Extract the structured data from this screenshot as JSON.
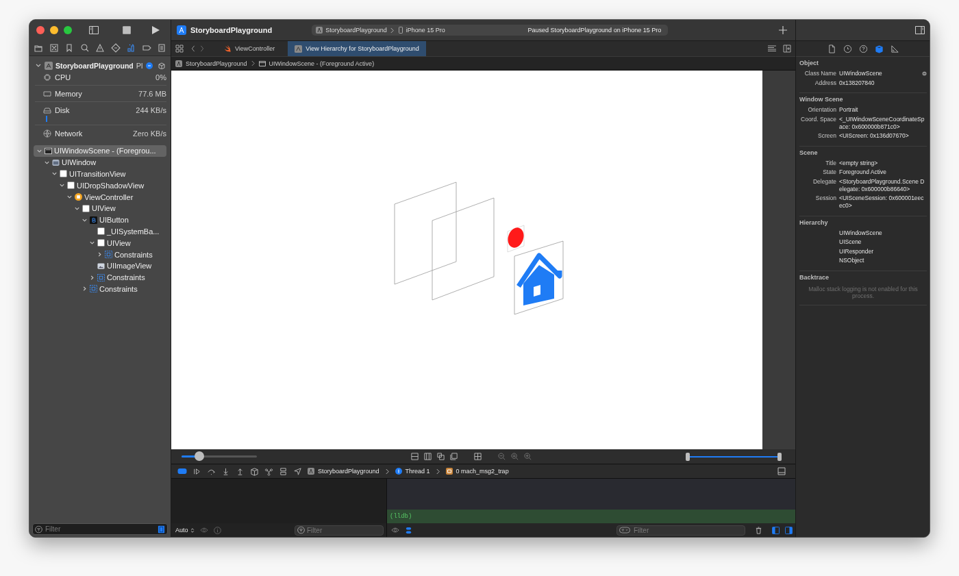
{
  "window": {
    "title": "StoryboardPlayground"
  },
  "toolbar": {
    "scheme": "StoryboardPlayground",
    "device": "iPhone 15 Pro",
    "status": "Paused StoryboardPlayground on iPhone 15 Pro"
  },
  "navigator_tabs": [
    {
      "selected": false
    },
    {
      "selected": false
    },
    {
      "selected": false
    },
    {
      "selected": false
    },
    {
      "selected": false
    },
    {
      "selected": false
    },
    {
      "selected": true
    },
    {
      "selected": false
    },
    {
      "selected": false
    }
  ],
  "process": {
    "name": "StoryboardPlayground",
    "name_suffix": "Pl",
    "metrics": [
      {
        "kind": "cpu",
        "label": "CPU",
        "value": "0%"
      },
      {
        "kind": "memory",
        "label": "Memory",
        "value": "77.6 MB"
      },
      {
        "kind": "disk",
        "label": "Disk",
        "value": "244 KB/s"
      },
      {
        "kind": "network",
        "label": "Network",
        "value": "Zero KB/s"
      }
    ]
  },
  "tree": [
    {
      "label": "UIWindowScene - (Foregrou...",
      "kind": "scene",
      "expandable": true,
      "expanded": true,
      "selected": true,
      "children": [
        {
          "label": "UIWindow",
          "kind": "window",
          "expandable": true,
          "expanded": true,
          "selected": false,
          "children": [
            {
              "label": "UITransitionView",
              "kind": "view",
              "expandable": true,
              "expanded": true,
              "selected": false,
              "children": [
                {
                  "label": "UIDropShadowView",
                  "kind": "view",
                  "expandable": true,
                  "expanded": true,
                  "selected": false,
                  "children": [
                    {
                      "label": "ViewController",
                      "kind": "controller",
                      "expandable": true,
                      "expanded": true,
                      "selected": false,
                      "children": [
                        {
                          "label": "UIView",
                          "kind": "view",
                          "expandable": true,
                          "expanded": true,
                          "selected": false,
                          "children": [
                            {
                              "label": "UIButton",
                              "kind": "button",
                              "expandable": true,
                              "expanded": true,
                              "selected": false,
                              "children": [
                                {
                                  "label": "_UISystemBa...",
                                  "kind": "view",
                                  "expandable": false,
                                  "selected": false
                                },
                                {
                                  "label": "UIView",
                                  "kind": "view",
                                  "expandable": true,
                                  "expanded": true,
                                  "selected": false,
                                  "children": [
                                    {
                                      "label": "Constraints",
                                      "kind": "constraints",
                                      "expandable": true,
                                      "expanded": false,
                                      "selected": false
                                    }
                                  ]
                                },
                                {
                                  "label": "UIImageView",
                                  "kind": "image",
                                  "expandable": false,
                                  "selected": false
                                },
                                {
                                  "label": "Constraints",
                                  "kind": "constraints",
                                  "expandable": true,
                                  "expanded": false,
                                  "selected": false
                                }
                              ]
                            },
                            {
                              "label": "Constraints",
                              "kind": "constraints",
                              "expandable": true,
                              "expanded": false,
                              "selected": false
                            }
                          ]
                        }
                      ]
                    }
                  ]
                }
              ]
            }
          ]
        }
      ]
    }
  ],
  "navigator_filter": {
    "placeholder": "Filter"
  },
  "editor_tabs": [
    {
      "label": "ViewController",
      "kind": "swift",
      "selected": false
    },
    {
      "label": "View Hierarchy for StoryboardPlayground",
      "kind": "hierarchy",
      "selected": true
    }
  ],
  "jump_bar": [
    "StoryboardPlayground",
    "UIWindowScene - (Foreground Active)"
  ],
  "canvas_controls": {
    "spacing_slider": {
      "level": 0.24
    },
    "range_slider": {
      "level": 1
    }
  },
  "debug_bar": {
    "breadcrumbs": [
      {
        "kind": "app",
        "label": "StoryboardPlayground"
      },
      {
        "kind": "thread",
        "label": "Thread 1"
      },
      {
        "kind": "frame",
        "label": "0 mach_msg2_trap"
      }
    ]
  },
  "variables": {
    "scope": "Auto",
    "filter_placeholder": "Filter"
  },
  "console": {
    "prompt": "(lldb)",
    "filter_placeholder": "Filter"
  },
  "inspector_tabs": [
    {
      "selected": false
    },
    {
      "selected": false
    },
    {
      "selected": false
    },
    {
      "selected": true
    },
    {
      "selected": false
    }
  ],
  "inspector": {
    "sections": [
      {
        "title": "Object",
        "rows": [
          {
            "label": "Class Name",
            "value": "UIWindowScene"
          },
          {
            "label": "Address",
            "value": "0x138207840"
          }
        ]
      },
      {
        "title": "Window Scene",
        "rows": [
          {
            "label": "Orientation",
            "value": "Portrait"
          },
          {
            "label": "Coord. Space",
            "value": "<_UIWindowSceneCoordinateSpace: 0x600000b871c0>"
          },
          {
            "label": "Screen",
            "value": "<UIScreen: 0x136d07670>"
          }
        ]
      },
      {
        "title": "Scene",
        "rows": [
          {
            "label": "Title",
            "value": "<empty string>"
          },
          {
            "label": "State",
            "value": "Foreground Active"
          },
          {
            "label": "Delegate",
            "value": "<StoryboardPlayground.Scene Delegate: 0x600000b86640>"
          },
          {
            "label": "Session",
            "value": "<UISceneSession: 0x600001eecec0>"
          }
        ]
      },
      {
        "title": "Hierarchy",
        "rows": [
          {
            "value": "UIWindowScene"
          },
          {
            "value": "UIScene"
          },
          {
            "value": "UIResponder"
          },
          {
            "value": "NSObject"
          }
        ]
      },
      {
        "title": "Backtrace",
        "note": "Malloc stack logging is not enabled for this process."
      }
    ]
  }
}
